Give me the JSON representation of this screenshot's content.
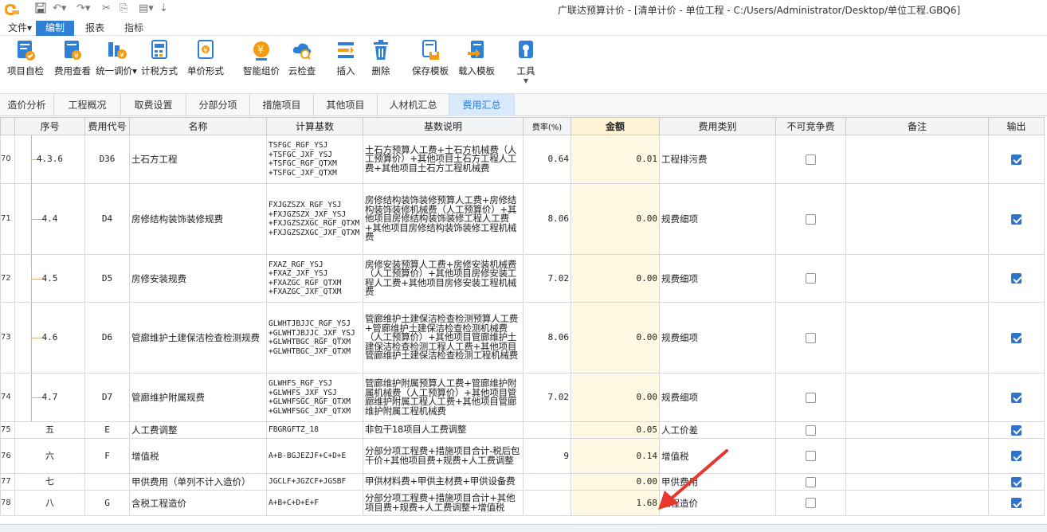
{
  "window": {
    "title": "广联达预算计价 - [清单计价 - 单位工程 - C:/Users/Administrator/Desktop/单位工程.GBQ6]"
  },
  "menubar": {
    "items": [
      "文件▾",
      "编制",
      "报表",
      "指标"
    ]
  },
  "ribbon": {
    "buttons": [
      {
        "label": "项目自检",
        "icon": "check-doc-icon"
      },
      {
        "label": "费用查看",
        "icon": "fee-view-icon"
      },
      {
        "label": "统一调价▾",
        "icon": "price-adjust-icon"
      },
      {
        "label": "计税方式",
        "icon": "tax-method-icon"
      },
      {
        "label": "单价形式",
        "icon": "unit-price-icon"
      },
      {
        "label": "智能组价",
        "icon": "smart-price-icon"
      },
      {
        "label": "云检查",
        "icon": "cloud-check-icon"
      },
      {
        "label": "插入",
        "icon": "insert-icon"
      },
      {
        "label": "删除",
        "icon": "delete-icon"
      },
      {
        "label": "保存模板",
        "icon": "save-template-icon"
      },
      {
        "label": "载入模板",
        "icon": "load-template-icon"
      },
      {
        "label": "工具",
        "icon": "tools-icon"
      }
    ]
  },
  "tabs": [
    "造价分析",
    "工程概况",
    "取费设置",
    "分部分项",
    "措施项目",
    "其他项目",
    "人材机汇总",
    "费用汇总"
  ],
  "active_tab": "费用汇总",
  "grid": {
    "columns": [
      "序号",
      "费用代号",
      "名称",
      "计算基数",
      "基数说明",
      "费率(%)",
      "金额",
      "费用类别",
      "不可竞争费",
      "备注",
      "输出"
    ],
    "rows": [
      {
        "no": "70",
        "seq": "4.3.6",
        "code": "D36",
        "name": "土石方工程",
        "base": "TSFGC_RGF_YSJ\n+TSFGC_JXF_YSJ\n+TSFGC_RGF_QTXM\n+TSFGC_JXF_QTXM",
        "desc": "土石方预算人工费+土石方机械费（人工预算价）+其他项目土石方工程人工费+其他项目土石方工程机械费",
        "rate": "0.64",
        "amount": "0.01",
        "category": "工程排污费",
        "noncomp": false,
        "remark": "",
        "output": true
      },
      {
        "no": "71",
        "seq": "4.4",
        "code": "D4",
        "name": "房修结构装饰装修规费",
        "base": "FXJGZSZX_RGF_YSJ\n+FXJGZSZX_JXF_YSJ\n+FXJGZSZXGC_RGF_QTXM\n+FXJGZSZXGC_JXF_QTXM",
        "desc": "房修结构装饰装修预算人工费+房修结构装饰装修机械费（人工预算价）+其他项目房修结构装饰装修工程人工费+其他项目房修结构装饰装修工程机械费",
        "rate": "8.06",
        "amount": "0.00",
        "category": "规费细项",
        "noncomp": false,
        "remark": "",
        "output": true
      },
      {
        "no": "72",
        "seq": "4.5",
        "code": "D5",
        "name": "房修安装规费",
        "base": "FXAZ_RGF_YSJ\n+FXAZ_JXF_YSJ\n+FXAZGC_RGF_QTXM\n+FXAZGC_JXF_QTXM",
        "desc": "房修安装预算人工费+房修安装机械费（人工预算价）+其他项目房修安装工程人工费+其他项目房修安装工程机械费",
        "rate": "7.02",
        "amount": "0.00",
        "category": "规费细项",
        "noncomp": false,
        "remark": "",
        "output": true
      },
      {
        "no": "73",
        "seq": "4.6",
        "code": "D6",
        "name": "管廊维护土建保洁检查检测规费",
        "base": "GLWHTJBJJC_RGF_YSJ\n+GLWHTJBJJC_JXF_YSJ\n+GLWHTBGC_RGF_QTXM\n+GLWHTBGC_JXF_QTXM",
        "desc": "管廊维护土建保洁检查检测预算人工费+管廊维护土建保洁检查检测机械费（人工预算价）+其他项目管廊维护土建保洁检查检测工程人工费+其他项目管廊维护土建保洁检查检测工程机械费",
        "rate": "8.06",
        "amount": "0.00",
        "category": "规费细项",
        "noncomp": false,
        "remark": "",
        "output": true
      },
      {
        "no": "74",
        "seq": "4.7",
        "code": "D7",
        "name": "管廊维护附属规费",
        "base": "GLWHFS_RGF_YSJ\n+GLWHFS_JXF_YSJ\n+GLWHFSGC_RGF_QTXM\n+GLWHFSGC_JXF_QTXM",
        "desc": "管廊维护附属预算人工费+管廊维护附属机械费（人工预算价）+其他项目管廊维护附属工程人工费+其他项目管廊维护附属工程机械费",
        "rate": "7.02",
        "amount": "0.00",
        "category": "规费细项",
        "noncomp": false,
        "remark": "",
        "output": true
      },
      {
        "no": "75",
        "seq": "五",
        "code": "E",
        "name": "人工费调整",
        "base": "FBGRGFTZ_18",
        "desc": "非包干18项目人工费调整",
        "rate": "",
        "amount": "0.05",
        "category": "人工价差",
        "noncomp": false,
        "remark": "",
        "output": true
      },
      {
        "no": "76",
        "seq": "六",
        "code": "F",
        "name": "增值税",
        "base": "A+B-BGJEZJF+C+D+E",
        "desc": "分部分项工程费+措施项目合计-税后包干价+其他项目费+规费+人工费调整",
        "rate": "9",
        "amount": "0.14",
        "category": "增值税",
        "noncomp": false,
        "remark": "",
        "output": true
      },
      {
        "no": "77",
        "seq": "七",
        "code": "",
        "name": "甲供费用（单列不计入造价）",
        "base": "JGCLF+JGZCF+JGSBF",
        "desc": "甲供材料费+甲供主材费+甲供设备费",
        "rate": "",
        "amount": "0.00",
        "category": "甲供费用",
        "noncomp": false,
        "remark": "",
        "output": true
      },
      {
        "no": "78",
        "seq": "八",
        "code": "G",
        "name": "含税工程造价",
        "base": "A+B+C+D+E+F",
        "desc": "分部分项工程费+措施项目合计+其他项目费+规费+人工费调整+增值税",
        "rate": "",
        "amount": "1.68",
        "category": "工程造价",
        "noncomp": false,
        "remark": "",
        "output": true
      }
    ]
  },
  "colors": {
    "accent": "#2e7fd6",
    "amount_header": "#fff3d6",
    "amount_cell": "#fff9e3",
    "annotation_arrow": "#e8372d",
    "checkbox_on": "#2d74cc"
  }
}
